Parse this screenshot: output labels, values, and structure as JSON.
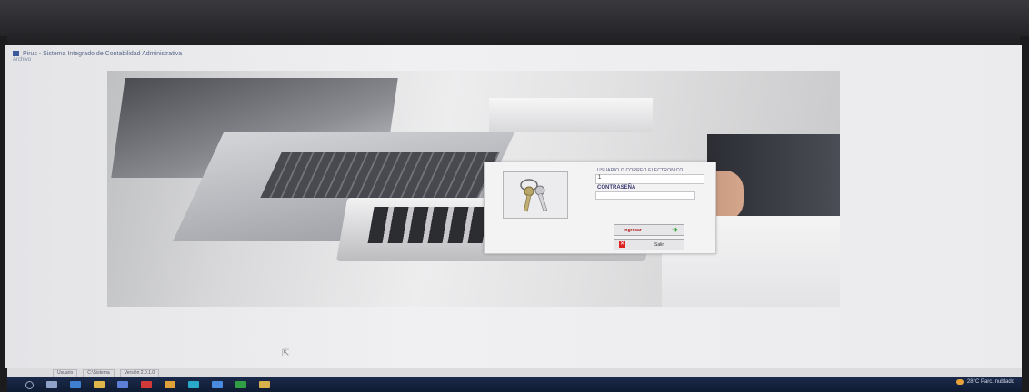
{
  "window": {
    "title": "Pirus - Sistema Integrado de Contabilidad Administrativa",
    "menu": "Archivo"
  },
  "login": {
    "user_label": "USUARIO O CORREO ELECTRONICO",
    "user_value": "1",
    "password_label": "CONTRASEÑA",
    "password_value": "",
    "login_button": "Ingresar",
    "exit_button": "Salir"
  },
  "status_bar": {
    "cells": [
      "Usuario",
      "C:\\Sistema",
      "Versión 2.0.1.0"
    ]
  },
  "taskbar": {
    "tray_text": "28°C  Parc. nublado"
  },
  "colors": {
    "taskbar": "#101b33",
    "login_accent": "#b02020",
    "go_arrow": "#2fa32f"
  }
}
